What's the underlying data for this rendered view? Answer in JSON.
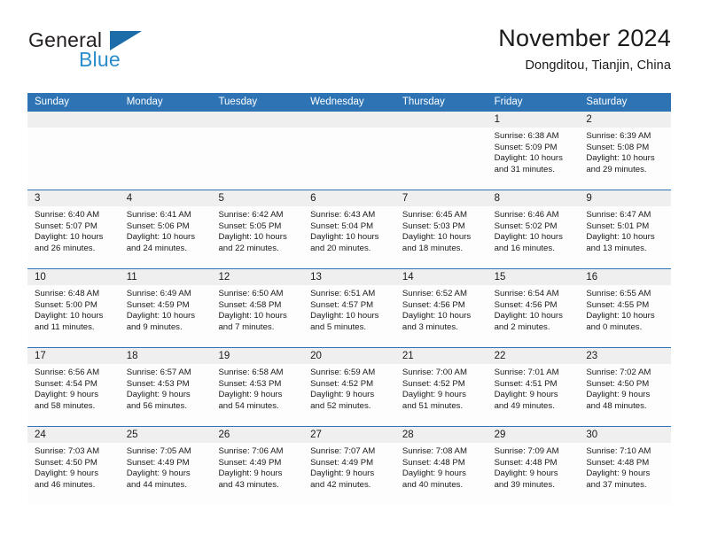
{
  "logo": {
    "word_one": "General",
    "word_two": "Blue",
    "triangle_icon": "triangle-icon",
    "accent_dark": "#1b6ca8",
    "accent_light": "#2b8ccc"
  },
  "header": {
    "title": "November 2024",
    "subtitle": "Dongditou, Tianjin, China"
  },
  "theme": {
    "header_blue": "#2e74b5",
    "daynum_band": "#efefef",
    "cell_bg": "#fdfdfd"
  },
  "calendar": {
    "weekday_headers": [
      "Sunday",
      "Monday",
      "Tuesday",
      "Wednesday",
      "Thursday",
      "Friday",
      "Saturday"
    ],
    "weeks": [
      [
        {
          "day": "",
          "empty": true
        },
        {
          "day": "",
          "empty": true
        },
        {
          "day": "",
          "empty": true
        },
        {
          "day": "",
          "empty": true
        },
        {
          "day": "",
          "empty": true
        },
        {
          "day": "1",
          "sunrise": "Sunrise: 6:38 AM",
          "sunset": "Sunset: 5:09 PM",
          "daylight1": "Daylight: 10 hours",
          "daylight2": "and 31 minutes."
        },
        {
          "day": "2",
          "sunrise": "Sunrise: 6:39 AM",
          "sunset": "Sunset: 5:08 PM",
          "daylight1": "Daylight: 10 hours",
          "daylight2": "and 29 minutes."
        }
      ],
      [
        {
          "day": "3",
          "sunrise": "Sunrise: 6:40 AM",
          "sunset": "Sunset: 5:07 PM",
          "daylight1": "Daylight: 10 hours",
          "daylight2": "and 26 minutes."
        },
        {
          "day": "4",
          "sunrise": "Sunrise: 6:41 AM",
          "sunset": "Sunset: 5:06 PM",
          "daylight1": "Daylight: 10 hours",
          "daylight2": "and 24 minutes."
        },
        {
          "day": "5",
          "sunrise": "Sunrise: 6:42 AM",
          "sunset": "Sunset: 5:05 PM",
          "daylight1": "Daylight: 10 hours",
          "daylight2": "and 22 minutes."
        },
        {
          "day": "6",
          "sunrise": "Sunrise: 6:43 AM",
          "sunset": "Sunset: 5:04 PM",
          "daylight1": "Daylight: 10 hours",
          "daylight2": "and 20 minutes."
        },
        {
          "day": "7",
          "sunrise": "Sunrise: 6:45 AM",
          "sunset": "Sunset: 5:03 PM",
          "daylight1": "Daylight: 10 hours",
          "daylight2": "and 18 minutes."
        },
        {
          "day": "8",
          "sunrise": "Sunrise: 6:46 AM",
          "sunset": "Sunset: 5:02 PM",
          "daylight1": "Daylight: 10 hours",
          "daylight2": "and 16 minutes."
        },
        {
          "day": "9",
          "sunrise": "Sunrise: 6:47 AM",
          "sunset": "Sunset: 5:01 PM",
          "daylight1": "Daylight: 10 hours",
          "daylight2": "and 13 minutes."
        }
      ],
      [
        {
          "day": "10",
          "sunrise": "Sunrise: 6:48 AM",
          "sunset": "Sunset: 5:00 PM",
          "daylight1": "Daylight: 10 hours",
          "daylight2": "and 11 minutes."
        },
        {
          "day": "11",
          "sunrise": "Sunrise: 6:49 AM",
          "sunset": "Sunset: 4:59 PM",
          "daylight1": "Daylight: 10 hours",
          "daylight2": "and 9 minutes."
        },
        {
          "day": "12",
          "sunrise": "Sunrise: 6:50 AM",
          "sunset": "Sunset: 4:58 PM",
          "daylight1": "Daylight: 10 hours",
          "daylight2": "and 7 minutes."
        },
        {
          "day": "13",
          "sunrise": "Sunrise: 6:51 AM",
          "sunset": "Sunset: 4:57 PM",
          "daylight1": "Daylight: 10 hours",
          "daylight2": "and 5 minutes."
        },
        {
          "day": "14",
          "sunrise": "Sunrise: 6:52 AM",
          "sunset": "Sunset: 4:56 PM",
          "daylight1": "Daylight: 10 hours",
          "daylight2": "and 3 minutes."
        },
        {
          "day": "15",
          "sunrise": "Sunrise: 6:54 AM",
          "sunset": "Sunset: 4:56 PM",
          "daylight1": "Daylight: 10 hours",
          "daylight2": "and 2 minutes."
        },
        {
          "day": "16",
          "sunrise": "Sunrise: 6:55 AM",
          "sunset": "Sunset: 4:55 PM",
          "daylight1": "Daylight: 10 hours",
          "daylight2": "and 0 minutes."
        }
      ],
      [
        {
          "day": "17",
          "sunrise": "Sunrise: 6:56 AM",
          "sunset": "Sunset: 4:54 PM",
          "daylight1": "Daylight: 9 hours",
          "daylight2": "and 58 minutes."
        },
        {
          "day": "18",
          "sunrise": "Sunrise: 6:57 AM",
          "sunset": "Sunset: 4:53 PM",
          "daylight1": "Daylight: 9 hours",
          "daylight2": "and 56 minutes."
        },
        {
          "day": "19",
          "sunrise": "Sunrise: 6:58 AM",
          "sunset": "Sunset: 4:53 PM",
          "daylight1": "Daylight: 9 hours",
          "daylight2": "and 54 minutes."
        },
        {
          "day": "20",
          "sunrise": "Sunrise: 6:59 AM",
          "sunset": "Sunset: 4:52 PM",
          "daylight1": "Daylight: 9 hours",
          "daylight2": "and 52 minutes."
        },
        {
          "day": "21",
          "sunrise": "Sunrise: 7:00 AM",
          "sunset": "Sunset: 4:52 PM",
          "daylight1": "Daylight: 9 hours",
          "daylight2": "and 51 minutes."
        },
        {
          "day": "22",
          "sunrise": "Sunrise: 7:01 AM",
          "sunset": "Sunset: 4:51 PM",
          "daylight1": "Daylight: 9 hours",
          "daylight2": "and 49 minutes."
        },
        {
          "day": "23",
          "sunrise": "Sunrise: 7:02 AM",
          "sunset": "Sunset: 4:50 PM",
          "daylight1": "Daylight: 9 hours",
          "daylight2": "and 48 minutes."
        }
      ],
      [
        {
          "day": "24",
          "sunrise": "Sunrise: 7:03 AM",
          "sunset": "Sunset: 4:50 PM",
          "daylight1": "Daylight: 9 hours",
          "daylight2": "and 46 minutes."
        },
        {
          "day": "25",
          "sunrise": "Sunrise: 7:05 AM",
          "sunset": "Sunset: 4:49 PM",
          "daylight1": "Daylight: 9 hours",
          "daylight2": "and 44 minutes."
        },
        {
          "day": "26",
          "sunrise": "Sunrise: 7:06 AM",
          "sunset": "Sunset: 4:49 PM",
          "daylight1": "Daylight: 9 hours",
          "daylight2": "and 43 minutes."
        },
        {
          "day": "27",
          "sunrise": "Sunrise: 7:07 AM",
          "sunset": "Sunset: 4:49 PM",
          "daylight1": "Daylight: 9 hours",
          "daylight2": "and 42 minutes."
        },
        {
          "day": "28",
          "sunrise": "Sunrise: 7:08 AM",
          "sunset": "Sunset: 4:48 PM",
          "daylight1": "Daylight: 9 hours",
          "daylight2": "and 40 minutes."
        },
        {
          "day": "29",
          "sunrise": "Sunrise: 7:09 AM",
          "sunset": "Sunset: 4:48 PM",
          "daylight1": "Daylight: 9 hours",
          "daylight2": "and 39 minutes."
        },
        {
          "day": "30",
          "sunrise": "Sunrise: 7:10 AM",
          "sunset": "Sunset: 4:48 PM",
          "daylight1": "Daylight: 9 hours",
          "daylight2": "and 37 minutes."
        }
      ]
    ]
  }
}
